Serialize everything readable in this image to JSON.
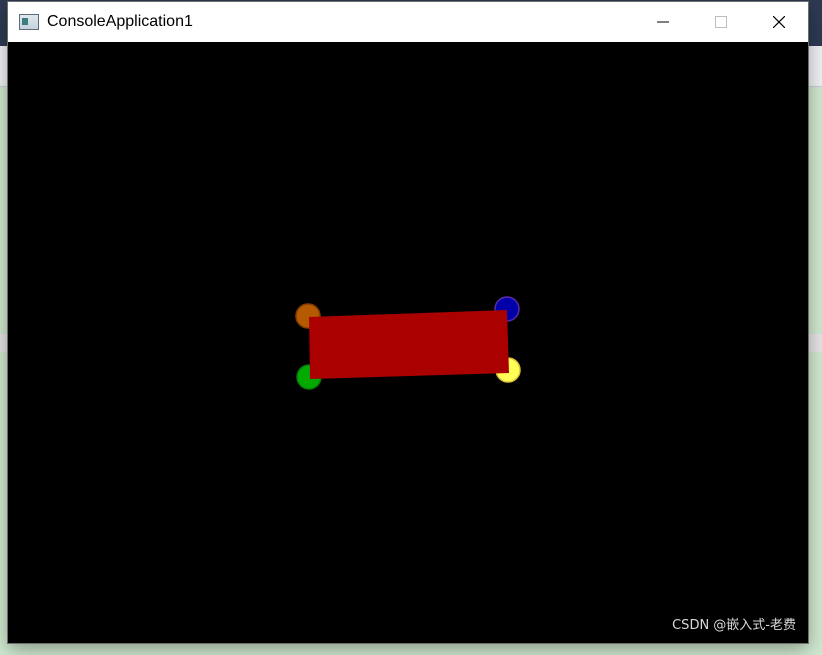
{
  "window": {
    "title": "ConsoleApplication1",
    "controls": {
      "minimize": "minimize",
      "maximize": "maximize",
      "close": "close"
    }
  },
  "scene": {
    "background_color": "#000000",
    "rectangle": {
      "color": "#aa0000"
    },
    "points": [
      {
        "name": "top-left",
        "color": "#b55a00",
        "border": "#8a3c00"
      },
      {
        "name": "top-right",
        "color": "#0000aa",
        "border": "#5c2aa8"
      },
      {
        "name": "bottom-left",
        "color": "#00aa00",
        "border": "#0b7a0b"
      },
      {
        "name": "bottom-right",
        "color": "#ffff55",
        "border": "#e0c23a"
      }
    ]
  },
  "watermark": "CSDN @嵌入式-老费"
}
